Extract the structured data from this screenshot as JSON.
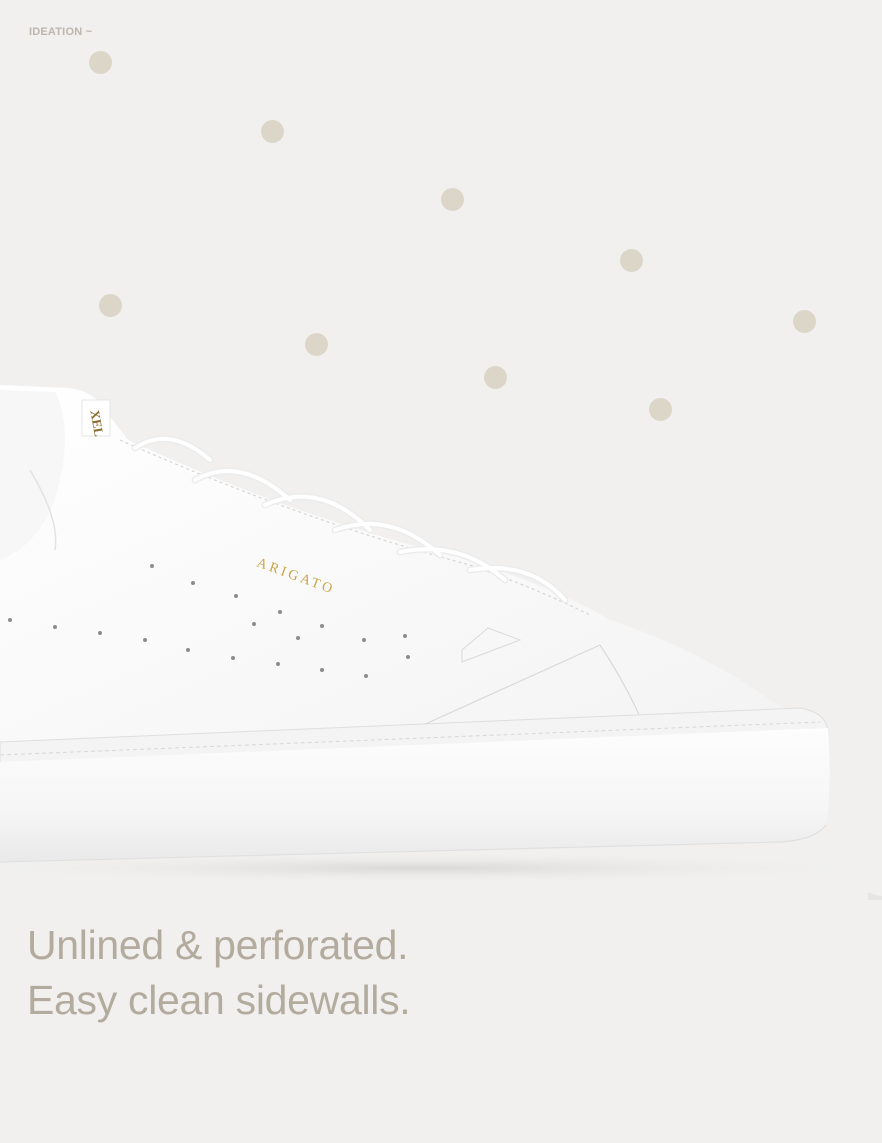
{
  "header": {
    "section_label": "IDEATION ~"
  },
  "product": {
    "brand_stamp": "ARIGATO",
    "tongue_label": "XEL"
  },
  "tagline": {
    "line1": "Unlined & perforated.",
    "line2": "Easy clean sidewalls."
  },
  "colors": {
    "background": "#f1f0ef",
    "dot": "#dcd6c9",
    "text": "#b3ab9d",
    "gold_stamp": "#c9a548"
  }
}
